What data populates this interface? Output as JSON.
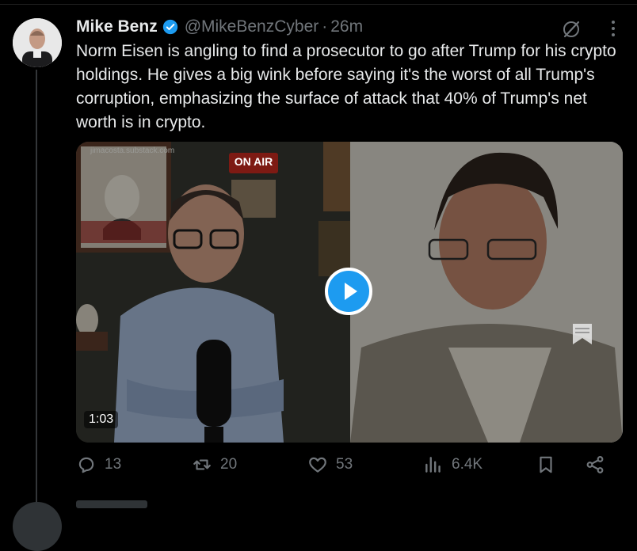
{
  "tweet": {
    "author_name": "Mike Benz",
    "handle": "@MikeBenzCyber",
    "separator": "·",
    "time": "26m",
    "text": "Norm Eisen is angling to find a prosecutor to go after Trump for his crypto holdings. He gives a big wink before saying it's the worst of all Trump's corruption, emphasizing the surface of attack that 40% of Trump's net worth is in crypto.",
    "media": {
      "watermark": "jimacosta.substack.com",
      "sign_text": "ON AIR",
      "duration": "1:03"
    },
    "actions": {
      "replies": "13",
      "reposts": "20",
      "likes": "53",
      "views": "6.4K"
    }
  },
  "colors": {
    "background": "#000000",
    "text_primary": "#e7e9ea",
    "text_secondary": "#71767b",
    "accent": "#1d9bf0"
  },
  "icons": [
    "verified-badge-icon",
    "grok-icon",
    "more-icon",
    "play-icon",
    "reply-icon",
    "repost-icon",
    "like-icon",
    "views-icon",
    "bookmark-icon",
    "share-icon"
  ]
}
